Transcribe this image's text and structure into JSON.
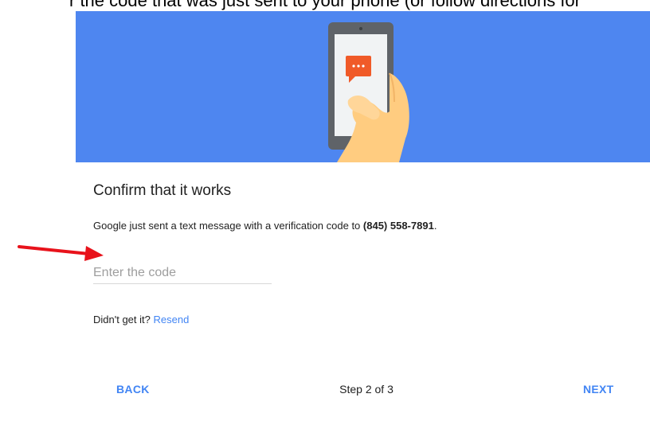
{
  "caption": {
    "text": "r the code that was just sent to your phone (or follow directions for"
  },
  "hero": {
    "background_color": "#4e86f0",
    "illustration": "phone-in-hand-with-message-icon",
    "message_color": "#f05a28"
  },
  "card": {
    "title": "Confirm that it works",
    "description_prefix": "Google just sent a text message with a verification code to ",
    "phone_number": "(845) 558-7891",
    "description_suffix": "."
  },
  "code_input": {
    "placeholder": "Enter the code",
    "value": ""
  },
  "annotation": {
    "arrow_color": "#e8121b"
  },
  "resend": {
    "prompt": "Didn't get it?",
    "link_label": "Resend"
  },
  "footer": {
    "back_label": "BACK",
    "step_label": "Step 2 of 3",
    "next_label": "NEXT"
  },
  "colors": {
    "accent": "#4285f4",
    "text": "#212121"
  }
}
